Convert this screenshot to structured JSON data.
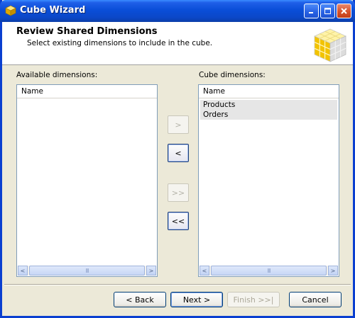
{
  "window": {
    "title": "Cube Wizard"
  },
  "header": {
    "title": "Review Shared Dimensions",
    "subtitle": "Select existing dimensions to include in the cube."
  },
  "available": {
    "label": "Available dimensions:",
    "column": "Name",
    "items": []
  },
  "cube": {
    "label": "Cube dimensions:",
    "column": "Name",
    "items": [
      "Products",
      "Orders"
    ]
  },
  "move_buttons": {
    "add_one": ">",
    "remove_one": "<",
    "add_all": ">>",
    "remove_all": "<<"
  },
  "scroll": {
    "left": "<",
    "right": ">",
    "grip": "III"
  },
  "nav": {
    "back": "< Back",
    "next": "Next >",
    "finish": "Finish >>|",
    "cancel": "Cancel"
  },
  "icons": {
    "app": "cube-icon",
    "minimize": "minimize-icon",
    "maximize": "maximize-icon",
    "close": "close-icon",
    "banner": "cube-graphic"
  },
  "colors": {
    "titlebar": "#0b47c8",
    "list_border": "#7f9db9",
    "cube_yellow": "#f2c300"
  }
}
